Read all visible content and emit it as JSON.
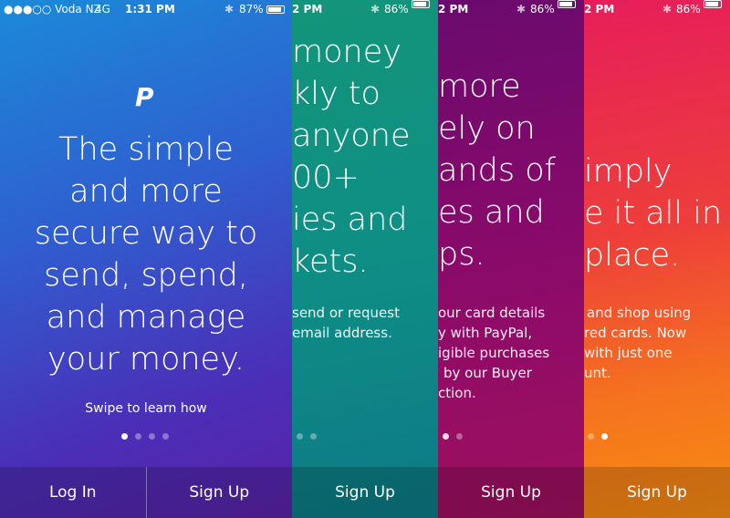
{
  "screens": [
    {
      "status": {
        "carrier": "●●●○○ Voda NZ",
        "network": "4G",
        "time": "1:31 PM",
        "battery": "87%"
      },
      "logo": "P",
      "headline": [
        "The simple",
        "and more",
        "secure way to",
        "send, spend,",
        "and manage",
        "your money."
      ],
      "swipe_hint": "Swipe to learn how",
      "buttons": {
        "login": "Log In",
        "signup": "Sign Up"
      }
    },
    {
      "status": {
        "time": "2 PM",
        "battery": "86%"
      },
      "headline": [
        "money",
        "kly to",
        "anyone",
        "00+",
        "ies and",
        "kets."
      ],
      "body": [
        "send or request",
        "email address."
      ],
      "buttons": {
        "signup": "Sign Up"
      }
    },
    {
      "status": {
        "time": "2 PM",
        "battery": "86%"
      },
      "headline": [
        "more",
        "ely on",
        "ands of",
        "es and",
        "ps."
      ],
      "body": [
        "our card details",
        "y with PayPal,",
        "igible purchases",
        "by our Buyer",
        "ction."
      ],
      "buttons": {
        "signup": "Sign Up"
      }
    },
    {
      "status": {
        "time": "2 PM",
        "battery": "86%"
      },
      "headline": [
        "imply",
        "e it all in",
        "place."
      ],
      "body": [
        "and shop using",
        "red cards. Now",
        "with just one",
        "unt."
      ],
      "buttons": {
        "signup": "Sign Up"
      }
    }
  ],
  "colors": {
    "screen1": "#2f5fd0",
    "screen2": "#0f8e85",
    "screen3": "#8a0a6a",
    "screen4": "#f5731e"
  }
}
